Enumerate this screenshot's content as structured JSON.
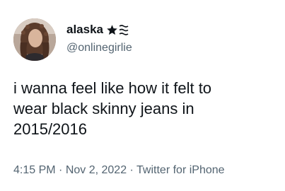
{
  "user": {
    "display_name": "alaska",
    "name_emoji": [
      "star-icon",
      "triple-wave-symbol-icon"
    ],
    "handle": "@onlinegirlie"
  },
  "tweet": {
    "text": "i wanna feel like how it felt to\nwear black skinny jeans in\n2015/2016",
    "time": "4:15 PM",
    "separator": " · ",
    "date": "Nov 2, 2022",
    "source": "Twitter for iPhone"
  },
  "colors": {
    "text_primary": "#0f1419",
    "text_secondary": "#536471",
    "background": "#ffffff"
  }
}
